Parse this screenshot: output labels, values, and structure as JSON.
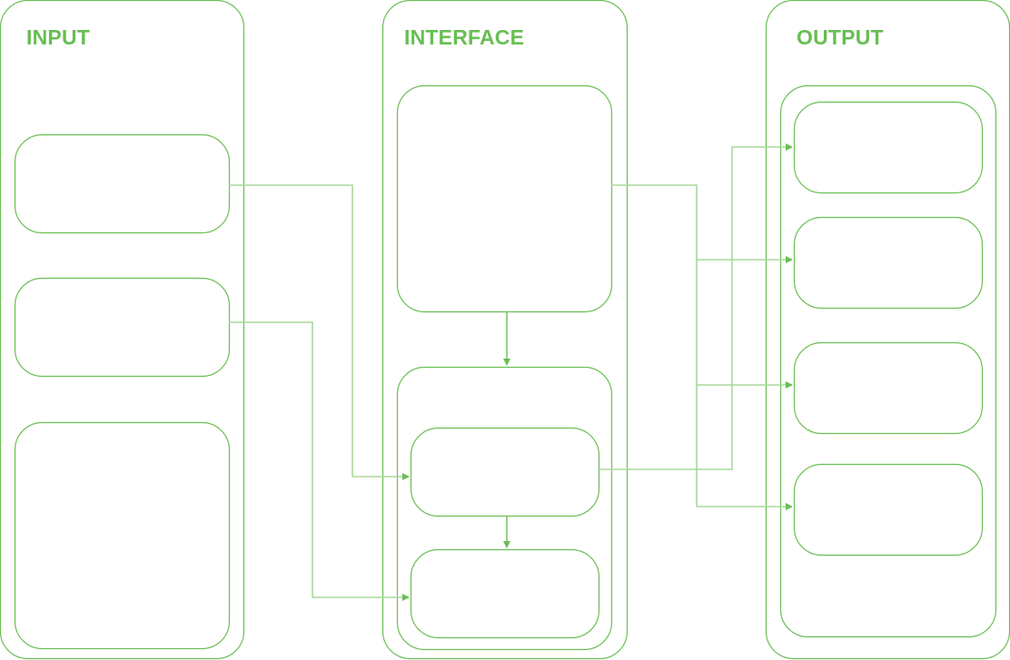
{
  "columns": [
    {
      "id": "input",
      "title": "INPUT"
    },
    {
      "id": "interface",
      "title": "INTERFACE"
    },
    {
      "id": "output",
      "title": "OUTPUT"
    }
  ],
  "colors": {
    "stroke": "#6abf55",
    "connector": "#a8d99a",
    "title": "#67be52"
  }
}
